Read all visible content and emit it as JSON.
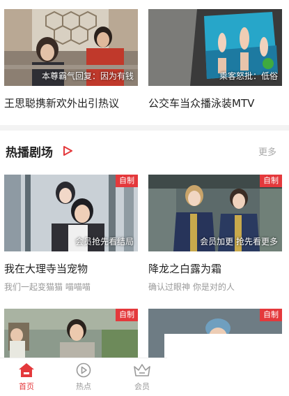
{
  "top_cards": [
    {
      "caption": "本尊霸气回复：因为有钱",
      "title": "王思聪携新欢外出引热议"
    },
    {
      "caption": "乘客怒批：低俗",
      "title": "公交车当众播泳装MTV"
    }
  ],
  "section": {
    "title": "热播剧场",
    "more": "更多"
  },
  "drama_cards": [
    {
      "badge": "自制",
      "caption": "会员抢先看结局",
      "title": "我在大理寺当宠物",
      "subtitle": "我们一起变猫猫 喵喵喵"
    },
    {
      "badge": "自制",
      "caption": "会员加更 抢先看更多",
      "title": "降龙之白露为霜",
      "subtitle": "确认过眼神 你是对的人"
    },
    {
      "badge": "自制"
    },
    {
      "badge": "自制"
    }
  ],
  "tabbar": {
    "items": [
      {
        "label": "首页",
        "icon": "home-icon",
        "active": true
      },
      {
        "label": "热点",
        "icon": "play-circle-icon",
        "active": false
      },
      {
        "label": "会员",
        "icon": "crown-icon",
        "active": false
      }
    ]
  },
  "colors": {
    "accent": "#e4393c",
    "muted": "#999999",
    "divider": "#f3f3f3"
  }
}
